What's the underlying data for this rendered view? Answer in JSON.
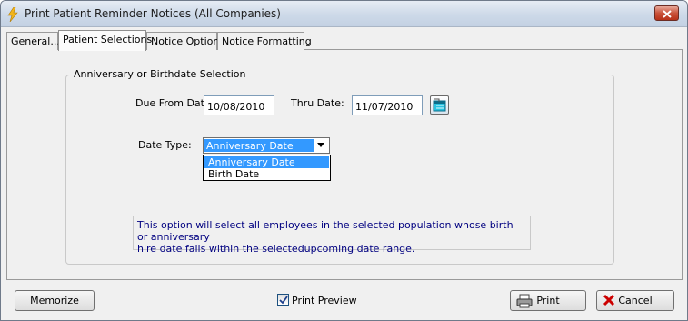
{
  "window": {
    "title": "Print Patient Reminder Notices (All Companies)"
  },
  "tabs": [
    {
      "label": "General...",
      "active": false
    },
    {
      "label": "Patient Selections",
      "active": true
    },
    {
      "label": "Notice Options",
      "active": false
    },
    {
      "label": "Notice Formatting",
      "active": false
    }
  ],
  "selection_group": {
    "title": "Anniversary or Birthdate Selection",
    "due_from_label": "Due From Date",
    "due_from_value": "10/08/2010",
    "thru_label": "Thru Date:",
    "thru_value": "11/07/2010",
    "date_type_label": "Date Type:",
    "date_type_value": "Anniversary Date",
    "date_type_options": [
      "Anniversary Date",
      "Birth Date"
    ],
    "info_text_line1": "This option will select all employees in the selected population whose birth or anniversary",
    "info_text_line2": "hire date falls within the selectedupcoming date range."
  },
  "footer": {
    "memorize_label": "Memorize",
    "print_preview_label": "Print Preview",
    "print_preview_checked": true,
    "print_label": "Print",
    "cancel_label": "Cancel"
  },
  "icons": {
    "title_icon": "lightning-icon",
    "close_icon": "close-icon",
    "calendar_icon": "calendar-icon",
    "dropdown_icon": "chevron-down-icon",
    "print_icon": "printer-icon",
    "cancel_icon": "red-x-icon",
    "check_icon": "checkmark-icon"
  },
  "colors": {
    "selection_blue": "#3399ff",
    "info_text": "#000080",
    "cancel_red": "#cc0000"
  }
}
